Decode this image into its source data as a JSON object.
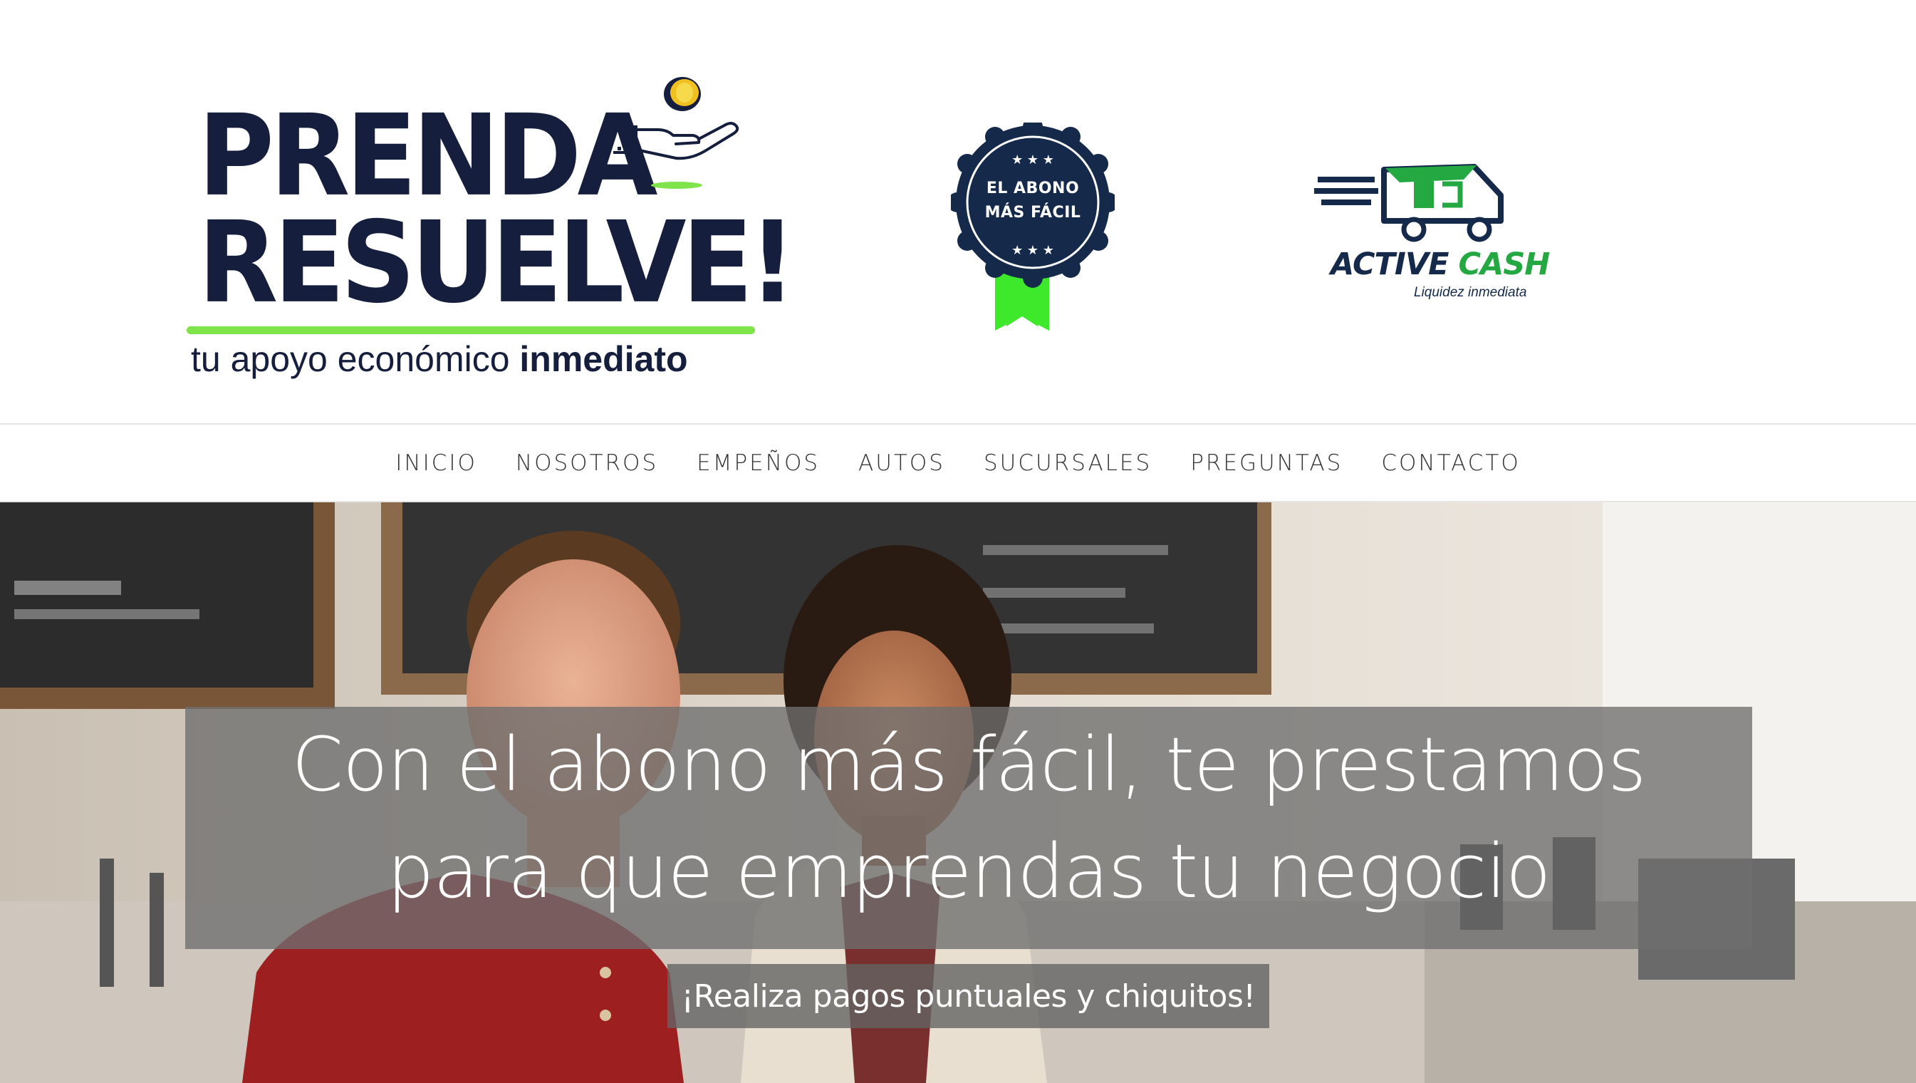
{
  "brand": {
    "logo_line1": "PRENDA",
    "logo_line2": "RESUELVE!",
    "tagline_regular": "tu apoyo económico ",
    "tagline_bold": "inmediato",
    "primary_color": "#151e3d",
    "accent_color": "#7fe34a"
  },
  "badge": {
    "line1": "EL ABONO",
    "line2": "MÁS FÁCIL",
    "color": "#15294a",
    "ribbon_color": "#3ee82b"
  },
  "partner": {
    "name_part1": "ACTIVE",
    "name_part2": "CASH",
    "subtitle": "Liquidez inmediata",
    "icon": "truck-icon"
  },
  "nav": {
    "items": [
      {
        "label": "INICIO"
      },
      {
        "label": "NOSOTROS"
      },
      {
        "label": "EMPEÑOS"
      },
      {
        "label": "AUTOS"
      },
      {
        "label": "SUCURSALES"
      },
      {
        "label": "PREGUNTAS"
      },
      {
        "label": "CONTACTO"
      }
    ]
  },
  "hero": {
    "headline_line1": "Con el abono más fácil, te prestamos",
    "headline_line2": "para que emprendas tu negocio",
    "cta_label": "¡Realiza pagos puntuales y chiquitos!"
  }
}
